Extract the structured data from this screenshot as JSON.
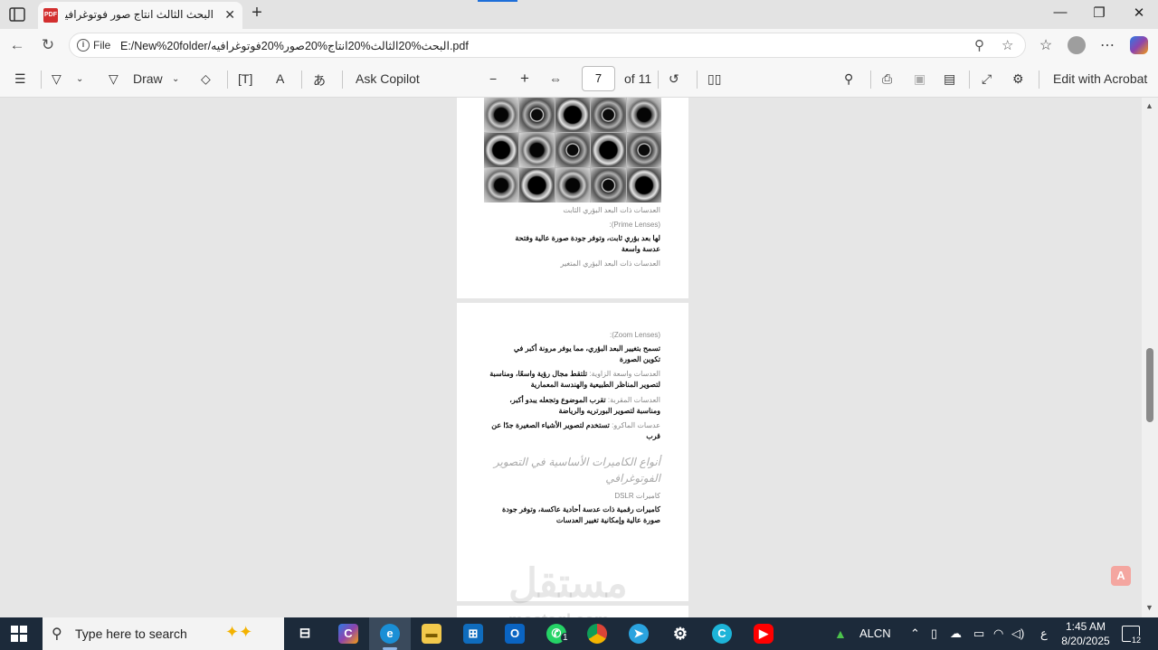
{
  "browser": {
    "tab_title": "البحث الثالث انتاج صور فوتوغرافيه.pdf",
    "tab_favicon_text": "PDF",
    "address_scheme": "File",
    "address_url": "E:/New%20folder/البحث%20الثالث%20انتاج%20صور%20فوتوغرافيه.pdf"
  },
  "pdf_toolbar": {
    "draw_label": "Draw",
    "ask_copilot": "Ask Copilot",
    "page_current": "7",
    "page_total": "of 11",
    "edit_acrobat": "Edit with Acrobat"
  },
  "pdf_content": {
    "page1": {
      "caption1": "العدسات ذات البعد البؤري الثابت",
      "caption2": "(Prime Lenses):",
      "desc": "لها بعد بؤري ثابت، وتوفر جودة صورة عالية وفتحة عدسة واسعة",
      "caption3": "العدسات ذات البعد البؤري المتغير"
    },
    "page2": {
      "zoom_label": "(Zoom Lenses):",
      "zoom_desc": "تسمح بتغيير البعد البؤري، مما يوفر مرونة أكبر في تكوين الصورة",
      "wide_label": "العدسات واسعة الزاوية:",
      "wide_desc": "تلتقط مجال رؤية واسعًا، ومناسبة لتصوير المناظر الطبيعية والهندسة المعمارية",
      "tele_label": "العدسات المقربة:",
      "tele_desc": "تقرب الموضوع وتجعله يبدو أكبر، ومناسبة لتصوير البورتريه والرياضة",
      "macro_label": "عدسات الماكرو:",
      "macro_desc": "تستخدم لتصوير الأشياء الصغيرة جدًا عن قرب",
      "heading": "أنواع الكاميرات الأساسية في التصوير الفوتوغرافي",
      "dslr_label": "كاميرات DSLR",
      "dslr_desc": "كاميرات رقمية ذات عدسة أحادية عاكسة، وتوفر جودة صورة عالية وإمكانية تغيير العدسات"
    }
  },
  "watermark": {
    "text": "مستقل",
    "sub": "mostaql.com"
  },
  "taskbar": {
    "search_placeholder": "Type here to search",
    "whatsapp_badge": "1",
    "keyboard_layout": "ALCN",
    "ime_char": "ع",
    "time": "1:45 AM",
    "date": "8/20/2025",
    "notif_count": "12"
  },
  "icons": [
    "tab-actions-icon",
    "pdf-icon",
    "close-icon",
    "plus-icon",
    "minimize-icon",
    "restore-icon",
    "back-icon",
    "refresh-icon",
    "info-icon",
    "zoom-icon",
    "star-icon",
    "favorites-icon",
    "profile-icon",
    "more-icon",
    "copilot-icon",
    "contents-icon",
    "highlight-icon",
    "draw-icon",
    "eraser-icon",
    "textbox-icon",
    "read-aloud-icon",
    "translate-icon",
    "zoom-out-icon",
    "zoom-in-icon",
    "fit-page-icon",
    "rotate-icon",
    "page-view-icon",
    "search-icon",
    "print-icon",
    "save-icon",
    "save-as-icon",
    "fullscreen-icon",
    "settings-icon"
  ],
  "colors": {
    "accent": "#1e6fd9",
    "taskbar": "#1c2a3a",
    "pdf_red": "#d32f2f"
  }
}
